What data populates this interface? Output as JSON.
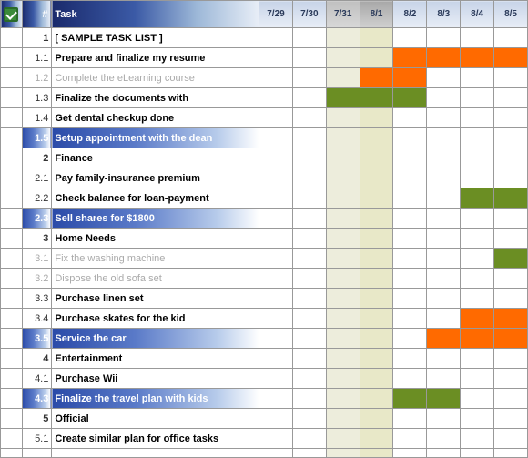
{
  "columns": {
    "check": "",
    "num": "#",
    "task": "Task",
    "dates": [
      {
        "label": "7/29",
        "cls": ""
      },
      {
        "label": "7/30",
        "cls": ""
      },
      {
        "label": "7/31",
        "cls": "weekend"
      },
      {
        "label": "8/1",
        "cls": "today"
      },
      {
        "label": "8/2",
        "cls": ""
      },
      {
        "label": "8/3",
        "cls": ""
      },
      {
        "label": "8/4",
        "cls": ""
      },
      {
        "label": "8/5",
        "cls": ""
      }
    ]
  },
  "rows": [
    {
      "num": "1",
      "task": "[ SAMPLE TASK LIST ]",
      "style": "category",
      "bars": []
    },
    {
      "num": "1.1",
      "task": "Prepare and finalize my resume",
      "style": "",
      "bars": [
        {
          "c": 4,
          "color": "orange"
        },
        {
          "c": 5,
          "color": "orange"
        },
        {
          "c": 6,
          "color": "orange"
        },
        {
          "c": 7,
          "color": "orange"
        }
      ]
    },
    {
      "num": "1.2",
      "task": "Complete the eLearning course",
      "style": "done",
      "bars": [
        {
          "c": 3,
          "color": "orange"
        },
        {
          "c": 4,
          "color": "orange"
        }
      ]
    },
    {
      "num": "1.3",
      "task": "Finalize the documents with",
      "style": "",
      "bars": [
        {
          "c": 2,
          "color": "green"
        },
        {
          "c": 3,
          "color": "green"
        },
        {
          "c": 4,
          "color": "green"
        }
      ]
    },
    {
      "num": "1.4",
      "task": "Get dental checkup done",
      "style": "",
      "bars": []
    },
    {
      "num": "1.5",
      "task": "Setup appointment with the dean",
      "style": "highlight",
      "bars": []
    },
    {
      "num": "2",
      "task": "Finance",
      "style": "category",
      "bars": []
    },
    {
      "num": "2.1",
      "task": "Pay family-insurance premium",
      "style": "",
      "bars": []
    },
    {
      "num": "2.2",
      "task": "Check balance for loan-payment",
      "style": "",
      "bars": [
        {
          "c": 6,
          "color": "green"
        },
        {
          "c": 7,
          "color": "green"
        }
      ]
    },
    {
      "num": "2.3",
      "task": "Sell shares for $1800",
      "style": "highlight",
      "bars": []
    },
    {
      "num": "3",
      "task": "Home Needs",
      "style": "category",
      "bars": []
    },
    {
      "num": "3.1",
      "task": "Fix the washing machine",
      "style": "done",
      "bars": [
        {
          "c": 7,
          "color": "green"
        }
      ]
    },
    {
      "num": "3.2",
      "task": "Dispose the old sofa set",
      "style": "done",
      "bars": []
    },
    {
      "num": "3.3",
      "task": "Purchase linen set",
      "style": "",
      "bars": []
    },
    {
      "num": "3.4",
      "task": "Purchase skates for the kid",
      "style": "",
      "bars": [
        {
          "c": 6,
          "color": "orange"
        },
        {
          "c": 7,
          "color": "orange"
        }
      ]
    },
    {
      "num": "3.5",
      "task": "Service the car",
      "style": "highlight",
      "bars": [
        {
          "c": 5,
          "color": "orange"
        },
        {
          "c": 6,
          "color": "orange"
        },
        {
          "c": 7,
          "color": "orange"
        }
      ]
    },
    {
      "num": "4",
      "task": "Entertainment",
      "style": "category",
      "bars": []
    },
    {
      "num": "4.1",
      "task": "Purchase Wii",
      "style": "",
      "bars": []
    },
    {
      "num": "4.3",
      "task": "Finalize the travel plan with kids",
      "style": "highlight",
      "bars": [
        {
          "c": 4,
          "color": "green"
        },
        {
          "c": 5,
          "color": "green"
        }
      ]
    },
    {
      "num": "5",
      "task": "Official",
      "style": "category",
      "bars": []
    },
    {
      "num": "5.1",
      "task": "Create similar plan for office tasks",
      "style": "",
      "bars": []
    }
  ]
}
